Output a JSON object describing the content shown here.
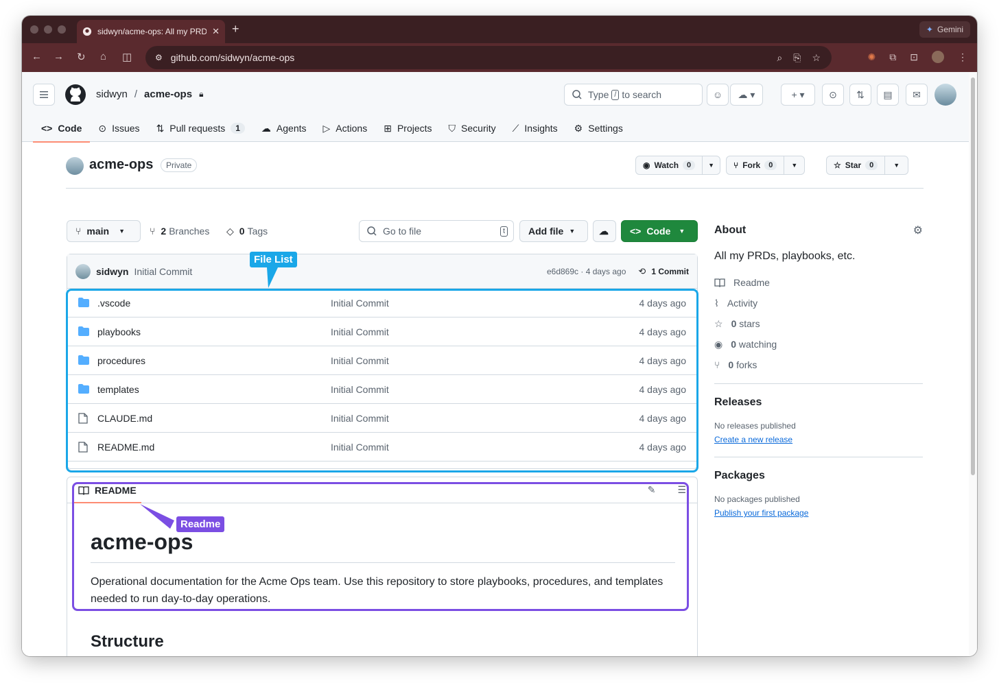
{
  "browser": {
    "tab_title": "sidwyn/acme-ops: All my PRD",
    "gemini_label": "Gemini",
    "url": "github.com/sidwyn/acme-ops"
  },
  "github": {
    "owner": "sidwyn",
    "separator": "/",
    "repo": "acme-ops",
    "search_prefix": "Type",
    "search_key": "/",
    "search_suffix": "to search",
    "nav": [
      {
        "label": "Code"
      },
      {
        "label": "Issues"
      },
      {
        "label": "Pull requests",
        "count": "1"
      },
      {
        "label": "Agents"
      },
      {
        "label": "Actions"
      },
      {
        "label": "Projects"
      },
      {
        "label": "Security"
      },
      {
        "label": "Insights"
      },
      {
        "label": "Settings"
      }
    ]
  },
  "repo_header": {
    "name": "acme-ops",
    "visibility": "Private",
    "watch_label": "Watch",
    "watch_count": "0",
    "fork_label": "Fork",
    "fork_count": "0",
    "star_label": "Star",
    "star_count": "0"
  },
  "filebar": {
    "branch": "main",
    "branches_count": "2",
    "branches_label": "Branches",
    "tags_count": "0",
    "tags_label": "Tags",
    "goto_placeholder": "Go to file",
    "goto_key": "t",
    "add_file": "Add file",
    "code_button": "Code"
  },
  "commit": {
    "author": "sidwyn",
    "message": "Initial Commit",
    "hash_info": "e6d869c · 4 days ago",
    "commits_count": "1 Commit"
  },
  "files": [
    {
      "name": ".vscode",
      "type": "folder",
      "message": "Initial Commit",
      "age": "4 days ago"
    },
    {
      "name": "playbooks",
      "type": "folder",
      "message": "Initial Commit",
      "age": "4 days ago"
    },
    {
      "name": "procedures",
      "type": "folder",
      "message": "Initial Commit",
      "age": "4 days ago"
    },
    {
      "name": "templates",
      "type": "folder",
      "message": "Initial Commit",
      "age": "4 days ago"
    },
    {
      "name": "CLAUDE.md",
      "type": "file",
      "message": "Initial Commit",
      "age": "4 days ago"
    },
    {
      "name": "README.md",
      "type": "file",
      "message": "Initial Commit",
      "age": "4 days ago"
    }
  ],
  "readme": {
    "tab_label": "README",
    "h1": "acme-ops",
    "paragraph": "Operational documentation for the Acme Ops team. Use this repository to store playbooks, procedures, and templates needed to run day-to-day operations.",
    "h2": "Structure"
  },
  "about": {
    "title": "About",
    "description": "All my PRDs, playbooks, etc.",
    "readme": "Readme",
    "activity": "Activity",
    "stars_count": "0",
    "stars_label": "stars",
    "watching_count": "0",
    "watching_label": "watching",
    "forks_count": "0",
    "forks_label": "forks"
  },
  "releases": {
    "title": "Releases",
    "none": "No releases published",
    "link": "Create a new release"
  },
  "packages": {
    "title": "Packages",
    "none": "No packages published",
    "link": "Publish your first package"
  },
  "annotations": {
    "file_list": "File List",
    "readme": "Readme",
    "file_list_color": "#1aa7e8",
    "readme_color": "#7b4ee3"
  }
}
